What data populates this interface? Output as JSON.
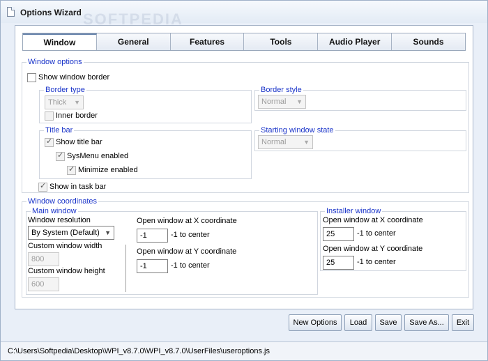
{
  "window": {
    "title": "Options Wizard",
    "watermark": "SOFTPEDIA"
  },
  "tabs": [
    {
      "label": "Window",
      "active": true
    },
    {
      "label": "General"
    },
    {
      "label": "Features"
    },
    {
      "label": "Tools"
    },
    {
      "label": "Audio Player"
    },
    {
      "label": "Sounds"
    }
  ],
  "window_options": {
    "legend": "Window options",
    "show_border": {
      "label": "Show window border",
      "checked": false
    },
    "border_type": {
      "legend": "Border type",
      "select_value": "Thick",
      "inner_border": {
        "label": "Inner border",
        "checked": false
      }
    },
    "border_style": {
      "legend": "Border style",
      "select_value": "Normal"
    },
    "title_bar": {
      "legend": "Title bar",
      "show_title_bar": {
        "label": "Show title bar",
        "checked": true
      },
      "sysmenu": {
        "label": "SysMenu enabled",
        "checked": true
      },
      "minimize": {
        "label": "Minimize enabled",
        "checked": true
      }
    },
    "starting_state": {
      "legend": "Starting window state",
      "select_value": "Normal"
    },
    "task_bar": {
      "label": "Show in task bar",
      "checked": true
    }
  },
  "window_coordinates": {
    "legend": "Window coordinates",
    "main_window": {
      "legend": "Main window",
      "resolution_label": "Window resolution",
      "resolution_value": "By System (Default)",
      "width_label": "Custom window width",
      "width_value": "800",
      "height_label": "Custom window height",
      "height_value": "600",
      "x_label": "Open window at X coordinate",
      "x_value": "-1",
      "x_hint": "-1 to center",
      "y_label": "Open window at Y coordinate",
      "y_value": "-1",
      "y_hint": "-1 to center"
    },
    "installer_window": {
      "legend": "Installer window",
      "x_label": "Open window at X coordinate",
      "x_value": "25",
      "x_hint": "-1 to center",
      "y_label": "Open window at Y coordinate",
      "y_value": "25",
      "y_hint": "-1 to center"
    }
  },
  "buttons": {
    "new_options": "New Options",
    "load": "Load",
    "save": "Save",
    "save_as": "Save As...",
    "exit": "Exit"
  },
  "status": {
    "path": "C:\\Users\\Softpedia\\Desktop\\WPI_v8.7.0\\WPI_v8.7.0\\UserFiles\\useroptions.js"
  },
  "icons": {
    "check_mark": "✓",
    "dropdown_arrow": "▼"
  }
}
